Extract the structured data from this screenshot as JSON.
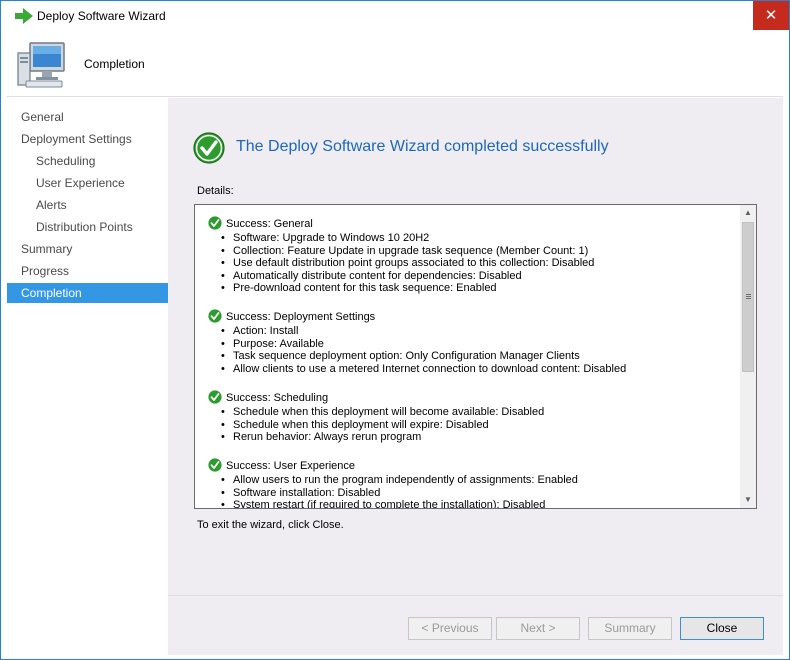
{
  "window": {
    "title": "Deploy Software Wizard",
    "close_glyph": "✕"
  },
  "header": {
    "title": "Completion",
    "icon": "computer-icon"
  },
  "nav": {
    "items": [
      {
        "label": "General"
      },
      {
        "label": "Deployment Settings"
      },
      {
        "label": "Scheduling"
      },
      {
        "label": "User Experience"
      },
      {
        "label": "Alerts"
      },
      {
        "label": "Distribution Points"
      },
      {
        "label": "Summary"
      },
      {
        "label": "Progress"
      },
      {
        "label": "Completion"
      }
    ],
    "active": "Completion",
    "active_color": "#3397e4"
  },
  "main": {
    "success_title": "The Deploy Software Wizard completed successfully",
    "details_label": "Details:",
    "exit_text": "To exit the wizard, click Close.",
    "sections": [
      {
        "heading": "Success: General",
        "bullets": [
          "Software: Upgrade to Windows 10 20H2",
          "Collection: Feature Update in upgrade task sequence (Member Count: 1)",
          "Use default distribution point groups associated to this collection: Disabled",
          "Automatically distribute content for dependencies: Disabled",
          "Pre-download content for this task sequence: Enabled"
        ]
      },
      {
        "heading": "Success: Deployment Settings",
        "bullets": [
          "Action: Install",
          "Purpose: Available",
          "Task sequence deployment option: Only Configuration Manager Clients",
          "Allow clients to use a metered Internet connection to download content: Disabled"
        ]
      },
      {
        "heading": "Success: Scheduling",
        "bullets": [
          "Schedule when this deployment will become available: Disabled",
          "Schedule when this deployment will expire: Disabled",
          "Rerun behavior: Always rerun program"
        ]
      },
      {
        "heading": "Success: User Experience",
        "bullets": [
          "Allow users to run the program independently of assignments: Enabled",
          "Software installation: Disabled",
          "System restart (if required to complete the installation): Disabled"
        ]
      }
    ]
  },
  "buttons": {
    "previous": "< Previous",
    "next": "Next >",
    "summary": "Summary",
    "close": "Close"
  },
  "colors": {
    "title_blue": "#1c68b8",
    "success_green": "#2e9b2e",
    "close_red": "#c42b1c"
  }
}
